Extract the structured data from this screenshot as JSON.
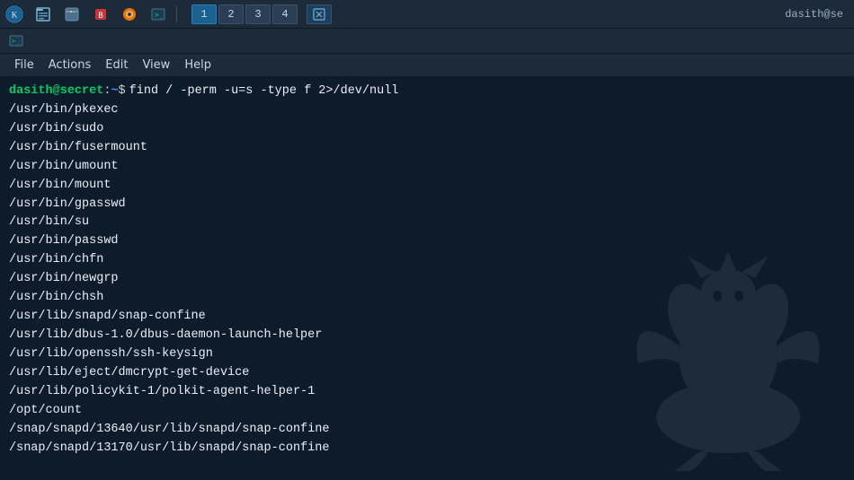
{
  "taskbar": {
    "username": "dasith@se",
    "tabs": [
      {
        "label": "1",
        "active": true
      },
      {
        "label": "2",
        "active": false
      },
      {
        "label": "3",
        "active": false
      },
      {
        "label": "4",
        "active": false
      }
    ],
    "special_tab": "⊡"
  },
  "menubar": {
    "items": [
      "File",
      "Actions",
      "Edit",
      "View",
      "Help"
    ]
  },
  "terminal": {
    "prompt": {
      "user": "dasith",
      "at": "@",
      "host": "secret",
      "colon": ":",
      "path": "~",
      "dollar": "$",
      "command": " find / -perm -u=s -type f 2>/dev/null"
    },
    "output_lines": [
      "/usr/bin/pkexec",
      "/usr/bin/sudo",
      "/usr/bin/fusermount",
      "/usr/bin/umount",
      "/usr/bin/mount",
      "/usr/bin/gpasswd",
      "/usr/bin/su",
      "/usr/bin/passwd",
      "/usr/bin/chfn",
      "/usr/bin/newgrp",
      "/usr/bin/chsh",
      "/usr/lib/snapd/snap-confine",
      "/usr/lib/dbus-1.0/dbus-daemon-launch-helper",
      "/usr/lib/openssh/ssh-keysign",
      "/usr/lib/eject/dmcrypt-get-device",
      "/usr/lib/policykit-1/polkit-agent-helper-1",
      "/opt/count",
      "/snap/snapd/13640/usr/lib/snapd/snap-confine",
      "/snap/snapd/13170/usr/lib/snapd/snap-confine"
    ]
  }
}
